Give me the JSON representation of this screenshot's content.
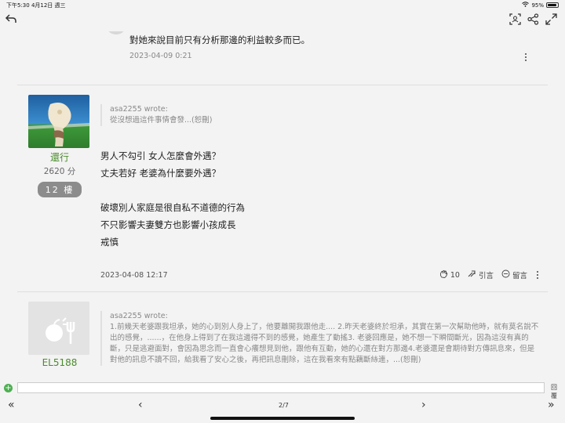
{
  "status_bar": {
    "time_date": "下午5:30  4月12日 週三",
    "battery": "95%",
    "battery_level": 0.95
  },
  "toolbar": {
    "back_icon": "back-arrow-icon",
    "scan_icon": "scan-icon",
    "share_icon": "share-icon",
    "expand_icon": "expand-icon"
  },
  "prev_post": {
    "text": "對她來說目前只有分析那邊的利益較多而已。",
    "date": "2023-04-09 0:21"
  },
  "post1": {
    "author": "還行",
    "score": "2620 分",
    "floor": "12 樓",
    "quote_author": "asa2255 wrote:",
    "quote_text": "從沒想過這件事情會發...(恕刪)",
    "lines": [
      "男人不勾引 女人怎麼會外遇？",
      "丈夫若好 老婆為什麼要外遇？",
      "",
      "破壞別人家庭是很自私不道德的行為",
      "不只影響夫妻雙方也影響小孩成長",
      "戒慎"
    ],
    "date": "2023-04-08 12:17",
    "likes": "10",
    "quote_label": "引言",
    "comment_label": "留言"
  },
  "post2": {
    "author": "EL5188",
    "quote_author": "asa2255 wrote:",
    "quote_text": "1.前幾天老婆跟我坦承，她的心到別人身上了，他要離開我跟他走.... 2.昨天老婆終於坦承，其實在第一次幫助他時，就有莫名說不出的感覺，......，在他身上得到了在我這邊得不到的感覺，她產生了動搖3. 老婆回應是，她不想一下瞬間斷光，因為這沒有真的斷，只是逃避面對，會因為思念而一直會心癢想見到他，跟他有互動，她的心還在對方那邊4.老婆還是會期待對方傳訊息來，但是對他的訊息不讀不回，給我看了安心之後，再把訊息刪除，這在我看來有點藕斷絲連，...(恕刪)"
  },
  "reply_bar": {
    "placeholder": "",
    "right_label": "回覆"
  },
  "pager": {
    "first": "«",
    "prev": "‹",
    "page": "2/7",
    "next": "›",
    "last": "»"
  }
}
